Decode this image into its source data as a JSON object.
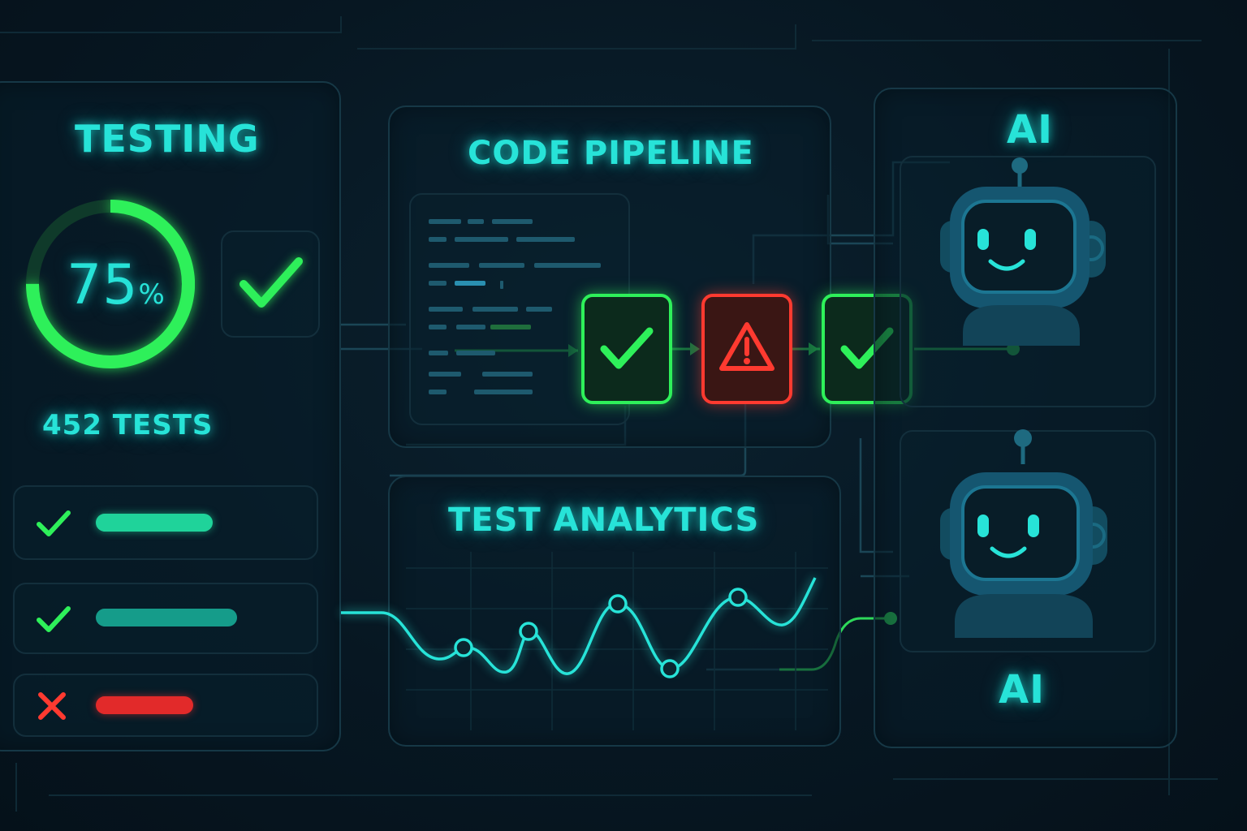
{
  "testing": {
    "title": "TESTING",
    "progress_percent": 75,
    "progress_label": "75",
    "percent_sign": "%",
    "tests_label": "452 TESTS",
    "results": [
      {
        "status": "pass",
        "bar_color": "#1fd39a"
      },
      {
        "status": "pass",
        "bar_color": "#159c8a"
      },
      {
        "status": "fail",
        "bar_color": "#e22a2a"
      }
    ]
  },
  "pipeline": {
    "title": "CODE PIPELINE",
    "stages": [
      {
        "status": "pass",
        "icon": "check-icon"
      },
      {
        "status": "fail",
        "icon": "warning-icon"
      },
      {
        "status": "pass",
        "icon": "check-icon"
      }
    ]
  },
  "analytics": {
    "title": "TEST ANALYTICS"
  },
  "ai": {
    "top_label": "AI",
    "bottom_label": "AI"
  },
  "colors": {
    "accent_cyan": "#27e3d8",
    "success_green": "#2ef05a",
    "error_red": "#ff3a30"
  }
}
